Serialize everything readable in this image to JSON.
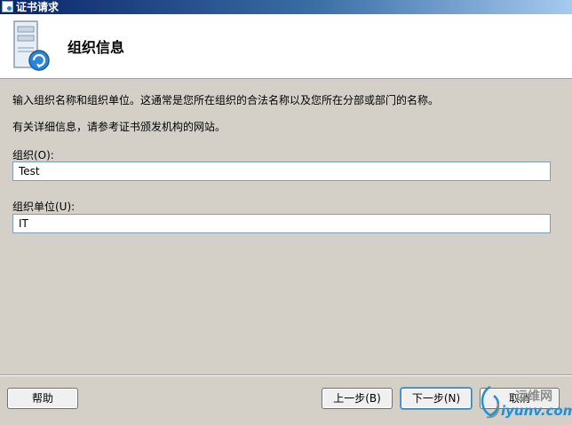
{
  "window": {
    "title": "证书请求"
  },
  "header": {
    "title": "组织信息"
  },
  "body": {
    "description": "输入组织名称和组织单位。这通常是您所在组织的合法名称以及您所在分部或部门的名称。",
    "more_info": "有关详细信息，请参考证书颁发机构的网站。"
  },
  "fields": {
    "organization": {
      "label": "组织(O):",
      "value": "Test"
    },
    "organizational_unit": {
      "label": "组织单位(U):",
      "value": "IT"
    }
  },
  "buttons": {
    "help": "帮助",
    "back": "上一步(B)",
    "next": "下一步(N)",
    "cancel": "取消"
  },
  "watermark": {
    "top": "运维网",
    "bottom": "iyunv.com"
  },
  "icons": {
    "app": "certificate-app-icon",
    "header": "certificate-server-icon"
  },
  "colors": {
    "titlebar_start": "#0a246a",
    "dialog_background": "#d4d0c8",
    "header_background": "#ffffff",
    "field_border": "#7f9db9"
  }
}
